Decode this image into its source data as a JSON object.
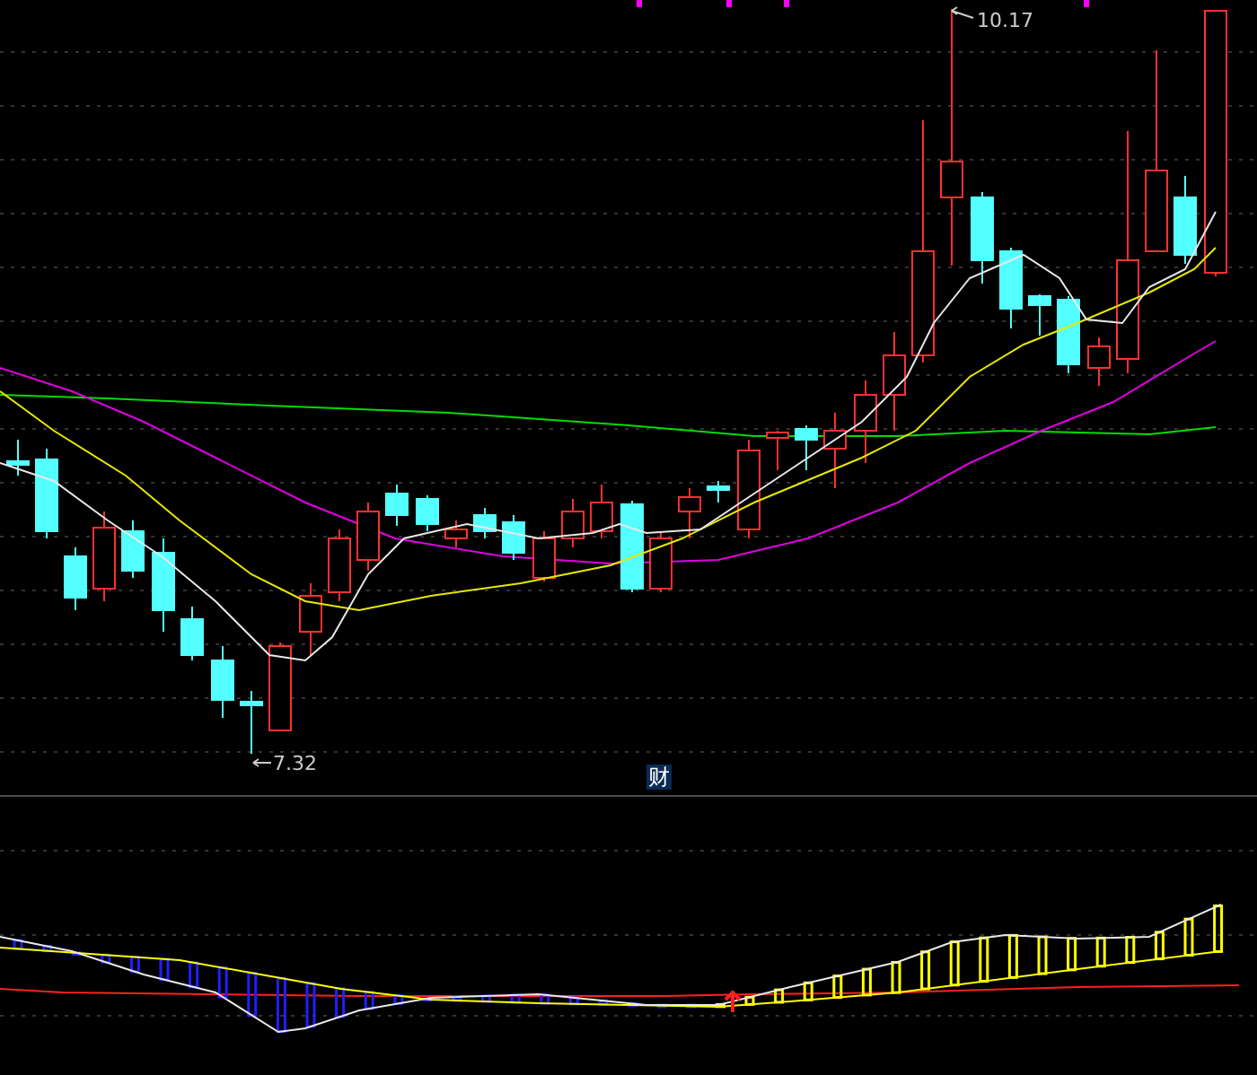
{
  "price_chart": {
    "high_label": "10.17",
    "low_label": "7.32"
  },
  "indicator_tag": "财"
}
